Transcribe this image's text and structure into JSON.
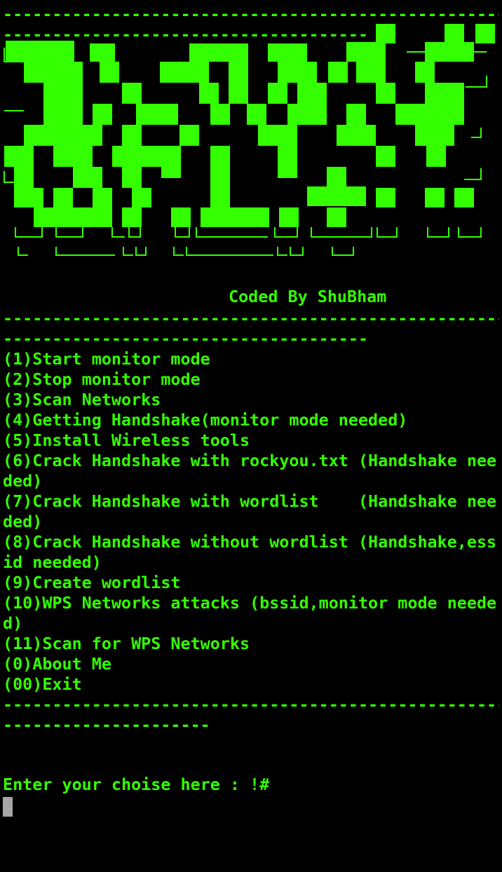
{
  "terminal": {
    "colors": {
      "text": "#33ff00",
      "background": "#000000",
      "cursor": "#a6a6a6"
    },
    "separator_full": "---------------------------------------------------",
    "separator_top_second": "-------------------------------------",
    "credit": "Coded By ShuBham",
    "separator_mid_second": "-------------------------------------",
    "menu": [
      "(1)Start monitor mode",
      "(2)Stop monitor mode",
      "(3)Scan Networks",
      "(4)Getting Handshake(monitor mode needed)",
      "(5)Install Wireless tools",
      "(6)Crack Handshake with rockyou.txt (Handshake nee",
      "ded)",
      "(7)Crack Handshake with wordlist    (Handshake nee",
      "ded)",
      "(8)Crack Handshake without wordlist (Handshake,ess",
      "id needed)",
      "(9)Create wordlist",
      "(10)WPS Networks attacks (bssid,monitor mode neede",
      "d)",
      "(11)Scan for WPS Networks",
      "(0)About Me",
      "(00)Exit"
    ],
    "separator_bottom_second": "---------------------",
    "prompt": "Enter your choise here : !#"
  }
}
